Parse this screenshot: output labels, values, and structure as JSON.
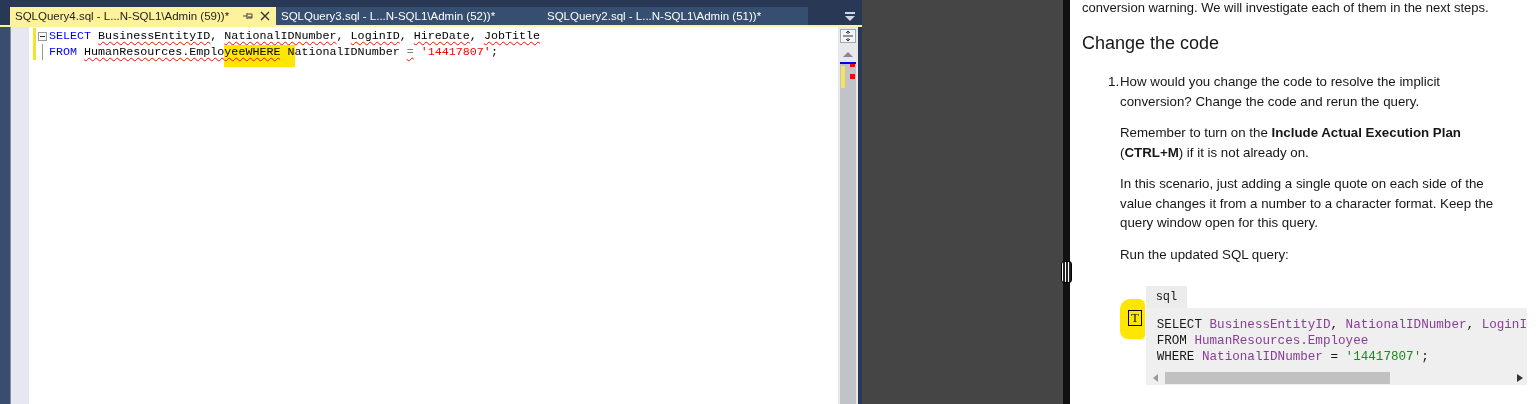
{
  "editor": {
    "tabs": [
      {
        "label": "SQLQuery4.sql - L...N-SQL1\\Admin (59))*",
        "selected": true
      },
      {
        "label": "SQLQuery3.sql - L...N-SQL1\\Admin (52))*",
        "selected": false
      },
      {
        "label": "SQLQuery2.sql - L...N-SQL1\\Admin (51))*",
        "selected": false
      }
    ],
    "lines": [
      {
        "collapsible": true,
        "changed": true,
        "tokens": [
          {
            "text": "SELECT ",
            "kind": "kw",
            "squiggle": false,
            "highlighted": false
          },
          {
            "text": "BusinessEntityID",
            "kind": "id",
            "squiggle": true,
            "highlighted": false
          },
          {
            "text": ", ",
            "kind": "pun",
            "squiggle": false,
            "highlighted": false
          },
          {
            "text": "NationalIDNumber",
            "kind": "id",
            "squiggle": true,
            "highlighted": false
          },
          {
            "text": ", ",
            "kind": "pun",
            "squiggle": false,
            "highlighted": false
          },
          {
            "text": "LoginID",
            "kind": "id",
            "squiggle": true,
            "highlighted": false
          },
          {
            "text": ", ",
            "kind": "pun",
            "squiggle": false,
            "highlighted": false
          },
          {
            "text": "HireDate",
            "kind": "id",
            "squiggle": true,
            "highlighted": false
          },
          {
            "text": ", ",
            "kind": "pun",
            "squiggle": false,
            "highlighted": false
          },
          {
            "text": "JobTitle",
            "kind": "id",
            "squiggle": true,
            "highlighted": false
          }
        ]
      },
      {
        "collapsible": false,
        "changed": true,
        "tokens": [
          {
            "text": "FROM ",
            "kind": "kw",
            "squiggle": false,
            "highlighted": false
          },
          {
            "text": "HumanResources.Emplo",
            "kind": "id",
            "squiggle": true,
            "highlighted": false
          },
          {
            "text": "yeeWHERE",
            "kind": "id",
            "squiggle": true,
            "highlighted": true
          },
          {
            "text": " N",
            "kind": "id",
            "squiggle": false,
            "highlighted": true
          },
          {
            "text": "ationalIDNumber ",
            "kind": "id",
            "squiggle": false,
            "highlighted": false
          },
          {
            "text": "=",
            "kind": "op",
            "squiggle": true,
            "highlighted": false
          },
          {
            "text": " '14417807'",
            "kind": "str",
            "squiggle": false,
            "highlighted": false
          },
          {
            "text": ";",
            "kind": "pun",
            "squiggle": false,
            "highlighted": false
          }
        ]
      }
    ]
  },
  "doc": {
    "intro": "conversion warning. We will investigate each of them in the next steps.",
    "heading": "Change the code",
    "steps": [
      {
        "number": "1.",
        "paragraphs": [
          "How would you change the code to resolve the implicit conversion? Change the code and rerun the query.",
          "Remember to turn on the **Include Actual Execution Plan** (**CTRL+M**) if it is not already on.",
          "In this scenario, just adding a single quote on each side of the value changes it from a number to a character format. Keep the query window open for this query.",
          "Run the updated SQL query:"
        ]
      }
    ],
    "annotation_marker": "T",
    "code_block": {
      "language": "sql",
      "lines": [
        [
          {
            "text": "SELECT ",
            "kind": "kw"
          },
          {
            "text": "BusinessEntityID",
            "kind": "id"
          },
          {
            "text": ", ",
            "kind": "pun"
          },
          {
            "text": "NationalIDNumber",
            "kind": "id"
          },
          {
            "text": ", ",
            "kind": "pun"
          },
          {
            "text": "LoginI",
            "kind": "id"
          }
        ],
        [
          {
            "text": "FROM ",
            "kind": "kw"
          },
          {
            "text": "HumanResources.Employee",
            "kind": "id"
          }
        ],
        [
          {
            "text": "WHERE ",
            "kind": "kw"
          },
          {
            "text": "NationalIDNumber",
            "kind": "id"
          },
          {
            "text": " = ",
            "kind": "pun"
          },
          {
            "text": "'14417807'",
            "kind": "str"
          },
          {
            "text": ";",
            "kind": "pun"
          }
        ]
      ]
    }
  }
}
